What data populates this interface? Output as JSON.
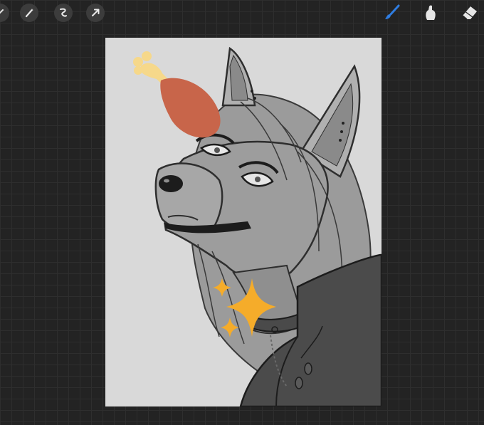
{
  "app": {
    "name": "drawing-app"
  },
  "toolbar": {
    "left_tools": [
      {
        "name": "adjustments-icon"
      },
      {
        "name": "magic-wand-icon"
      },
      {
        "name": "selection-icon"
      },
      {
        "name": "transform-arrow-icon"
      }
    ],
    "right_tools": [
      {
        "name": "brush-icon",
        "active": true
      },
      {
        "name": "smudge-icon",
        "active": false
      },
      {
        "name": "eraser-icon",
        "active": false
      }
    ]
  },
  "colors": {
    "accent": "#2f7de1",
    "canvas": "#d9d9d9",
    "drumstick_meat": "#c8654a",
    "drumstick_bone": "#f6d88a",
    "sparkle": "#f5ac2a"
  }
}
